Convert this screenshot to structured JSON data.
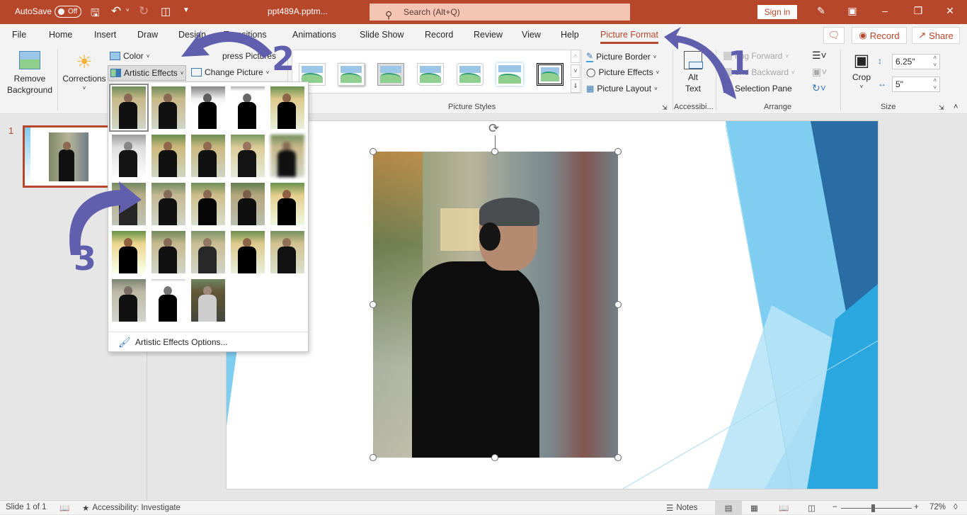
{
  "titlebar": {
    "autosave_label": "AutoSave",
    "autosave_state": "Off",
    "doc_title": "ppt489A.pptm...",
    "search_placeholder": "Search (Alt+Q)",
    "signin_label": "Sign in",
    "icons": [
      "save-icon",
      "undo-icon",
      "redo-icon",
      "present-icon",
      "customize-qat-icon",
      "designer-icon",
      "ribbon-display-icon",
      "minimize-icon",
      "restore-icon",
      "close-icon"
    ]
  },
  "tabs": [
    {
      "label": "File"
    },
    {
      "label": "Home"
    },
    {
      "label": "Insert"
    },
    {
      "label": "Draw"
    },
    {
      "label": "Design"
    },
    {
      "label": "Transitions"
    },
    {
      "label": "Animations"
    },
    {
      "label": "Slide Show"
    },
    {
      "label": "Record"
    },
    {
      "label": "Review"
    },
    {
      "label": "View"
    },
    {
      "label": "Help"
    },
    {
      "label": "Picture Format",
      "active": true
    }
  ],
  "header_buttons": {
    "comments": "comments-icon",
    "record": "Record",
    "share": "Share"
  },
  "ribbon": {
    "adjust": {
      "remove_background": "Remove Background",
      "remove_background_l1": "Remove",
      "remove_background_l2": "Background",
      "corrections": "Corrections",
      "color": "Color",
      "artistic_effects": "Artistic Effects",
      "compress_pictures": "Compress Pictures",
      "compress_visible": "press Pictures",
      "change_picture": "Change Picture"
    },
    "picture_styles": {
      "group_label": "Picture Styles",
      "picture_border": "Picture Border",
      "picture_effects": "Picture Effects",
      "picture_layout": "Picture Layout",
      "style_count": 7
    },
    "accessibility": {
      "alt_text_l1": "Alt",
      "alt_text_l2": "Text",
      "group_label": "Accessibi..."
    },
    "arrange": {
      "bring_forward": "ring Forward",
      "send_backward": "end Backward",
      "selection_pane": "Selection Pane",
      "group_label": "Arrange"
    },
    "size": {
      "crop": "Crop",
      "height": "6.25\"",
      "width": "5\"",
      "group_label": "Size"
    }
  },
  "artistic_effects_menu": {
    "rows": 5,
    "effects": [
      "None",
      "Marker",
      "Pencil Grayscale",
      "Pencil Sketch",
      "Line Drawing",
      "Chalk Sketch",
      "Paint Strokes",
      "Paint Brush",
      "Glow Diffused",
      "Blur",
      "Light Screen",
      "Watercolor Sponge",
      "Film Grain",
      "Mosaic Bubbles",
      "Glass",
      "Cement",
      "Texturizer",
      "Crisscross Etching",
      "Pastels Smooth",
      "Plastic Wrap",
      "Cutout",
      "Photocopy",
      "Glow Edges"
    ],
    "selected_index": 0,
    "options_label": "Artistic Effects Options..."
  },
  "thumbnail_pane": {
    "slide_number": "1"
  },
  "annotations": {
    "step1": "1",
    "step2": "2",
    "step3": "3",
    "color": "#5f5fae"
  },
  "statusbar": {
    "slide_info": "Slide 1 of 1",
    "accessibility": "Accessibility: Investigate",
    "notes": "Notes",
    "zoom_level": "72%",
    "zoom_fraction": 0.45
  },
  "colors": {
    "accent": "#b7472a",
    "search_bg": "#f4c5b3",
    "slide_blue_dark": "#2a6ca4",
    "slide_blue_light": "#7fcdf0"
  }
}
